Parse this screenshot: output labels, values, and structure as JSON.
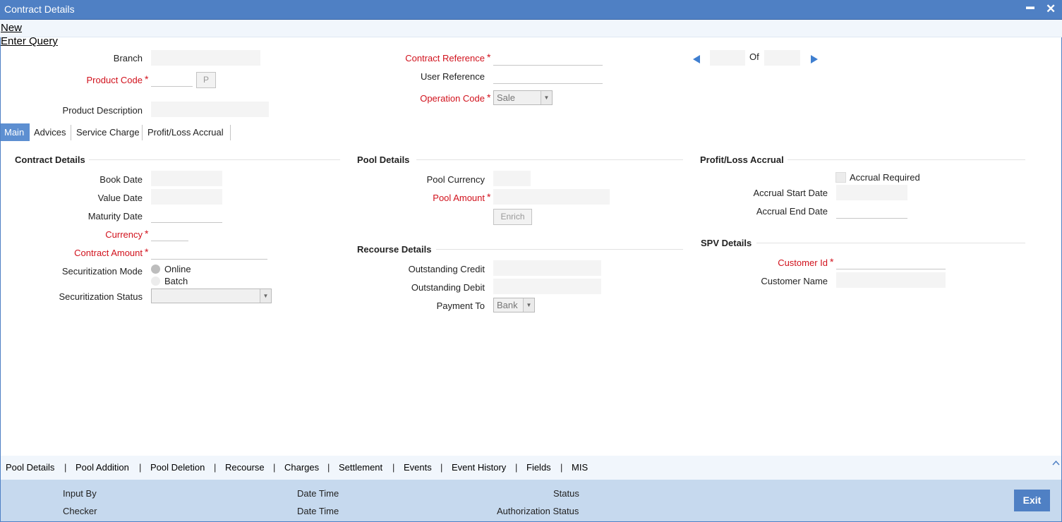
{
  "window": {
    "title": "Contract Details",
    "minimize": "▬",
    "close": "✕"
  },
  "menu": {
    "new": "New",
    "enter_query": "Enter Query"
  },
  "header": {
    "branch": "Branch",
    "product_code": "Product Code",
    "product_button": "P",
    "product_description": "Product Description",
    "contract_reference": "Contract Reference",
    "user_reference": "User Reference",
    "operation_code": "Operation Code",
    "operation_code_value": "Sale",
    "of": "Of",
    "required_mark": "*"
  },
  "tabs": [
    "Main",
    "Advices",
    "Service Charge",
    "Profit/Loss Accrual"
  ],
  "contract_details": {
    "title": "Contract Details",
    "book_date": "Book Date",
    "value_date": "Value Date",
    "maturity_date": "Maturity Date",
    "currency": "Currency",
    "contract_amount": "Contract Amount",
    "securitization_mode": "Securitization Mode",
    "online": "Online",
    "batch": "Batch",
    "securitization_status": "Securitization Status"
  },
  "pool_details": {
    "title": "Pool Details",
    "pool_currency": "Pool Currency",
    "pool_amount": "Pool Amount",
    "enrich": "Enrich"
  },
  "recourse_details": {
    "title": "Recourse Details",
    "outstanding_credit": "Outstanding Credit",
    "outstanding_debit": "Outstanding Debit",
    "payment_to": "Payment To",
    "payment_to_value": "Bank"
  },
  "profit_loss": {
    "title": "Profit/Loss Accrual",
    "accrual_required": "Accrual Required",
    "accrual_start_date": "Accrual Start Date",
    "accrual_end_date": "Accrual End Date"
  },
  "spv_details": {
    "title": "SPV Details",
    "customer_id": "Customer Id",
    "customer_name": "Customer Name"
  },
  "bottom_links": [
    "Pool Details",
    "Pool Addition",
    "Pool Deletion",
    "Recourse",
    "Charges",
    "Settlement",
    "Events",
    "Event History",
    "Fields",
    "MIS"
  ],
  "bottom_separator": "|",
  "audit": {
    "input_by": "Input By",
    "checker": "Checker",
    "date_time_1": "Date Time",
    "date_time_2": "Date Time",
    "status": "Status",
    "authorization_status": "Authorization Status"
  },
  "exit": "Exit",
  "colors": {
    "title_bar": "#4f80c4",
    "active_tab": "#5d8fd1",
    "required": "#d1111c",
    "audit_bar": "#c6d9ee"
  }
}
